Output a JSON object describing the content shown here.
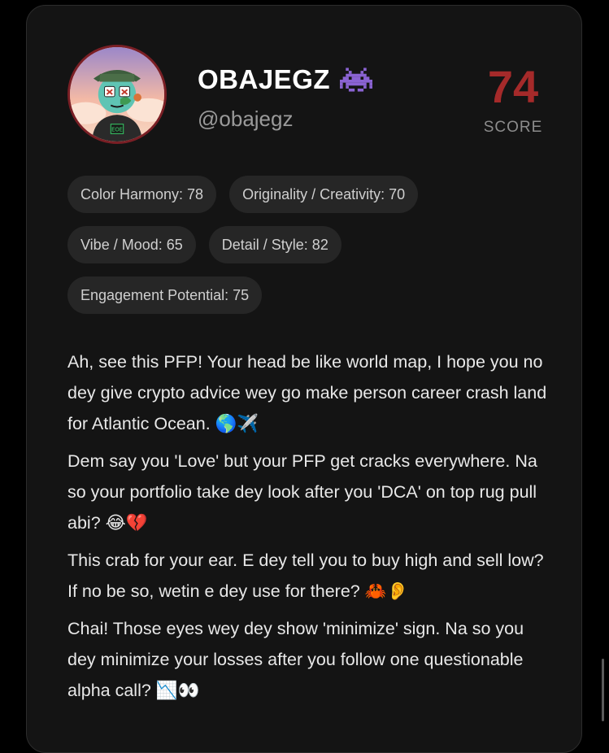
{
  "profile": {
    "display_name": "OBAJEGZ",
    "badge_icon": "space-invader-icon",
    "handle": "@obajegz",
    "avatar_icon": "avatar-image",
    "avatar_logo_text": "EOE"
  },
  "score": {
    "value": "74",
    "label": "SCORE",
    "color": "#a52a2a"
  },
  "metrics": [
    {
      "label": "Color Harmony: 78"
    },
    {
      "label": "Originality / Creativity: 70"
    },
    {
      "label": "Vibe / Mood: 65"
    },
    {
      "label": "Detail / Style: 82"
    },
    {
      "label": "Engagement Potential: 75"
    }
  ],
  "roast": [
    "Ah, see this PFP! Your head be like world map, I hope you no dey give crypto advice wey go make person career crash land for Atlantic Ocean. 🌎✈️",
    "Dem say you 'Love' but your PFP get cracks everywhere. Na so your portfolio take dey look after you 'DCA' on top rug pull abi? 😂💔",
    "This crab for your ear. E dey tell you to buy high and sell low? If no be so, wetin e dey use for there? 🦀👂",
    "Chai! Those eyes wey dey show 'minimize' sign. Na so you dey minimize your losses after you follow one questionable alpha call? 📉👀"
  ],
  "colors": {
    "card_background": "#141414",
    "chip_background": "#262626",
    "accent_red": "#a52a2a"
  }
}
